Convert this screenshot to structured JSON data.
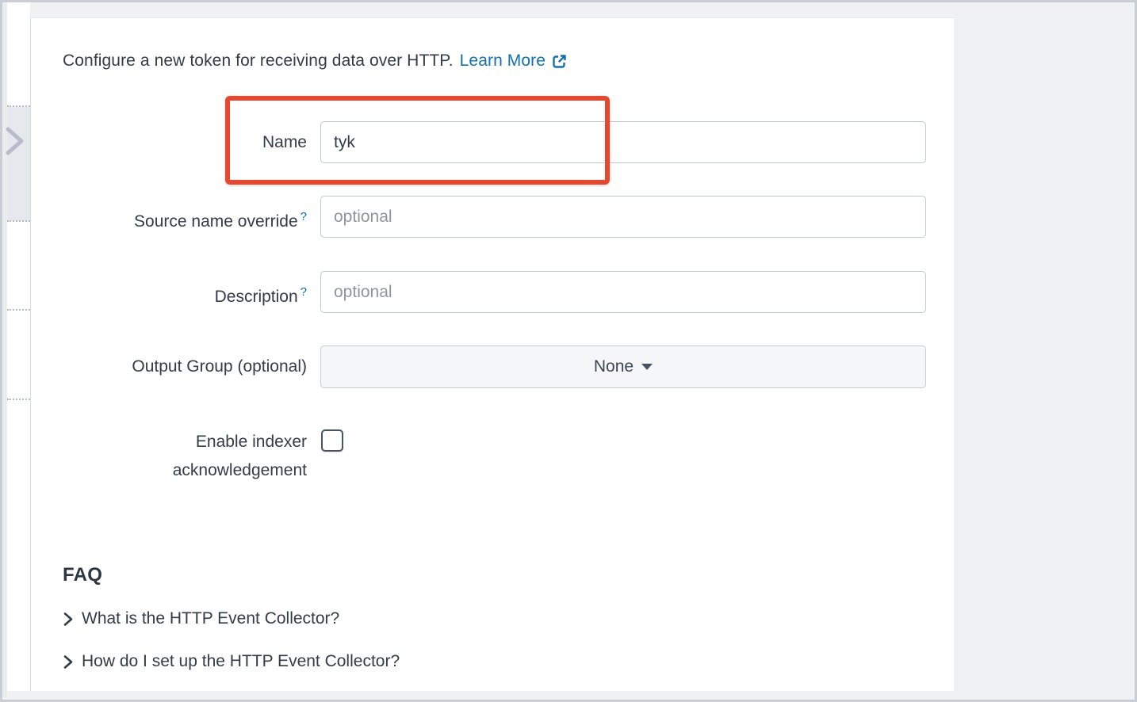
{
  "header": {
    "intro_text": "Configure a new token for receiving data over HTTP.",
    "learn_more_label": "Learn More"
  },
  "form": {
    "name": {
      "label": "Name",
      "value": "tyk"
    },
    "source_override": {
      "label": "Source name override",
      "help": "?",
      "placeholder": "optional"
    },
    "description": {
      "label": "Description",
      "help": "?",
      "placeholder": "optional"
    },
    "output_group": {
      "label": "Output Group (optional)",
      "selected_value": "None"
    },
    "indexer_ack": {
      "label_line1": "Enable indexer",
      "label_line2": "acknowledgement",
      "checked": false
    }
  },
  "faq": {
    "title": "FAQ",
    "items": [
      {
        "label": "What is the HTTP Event Collector?"
      },
      {
        "label": "How do I set up the HTTP Event Collector?"
      }
    ]
  },
  "annotation": {
    "type": "highlight-box",
    "color": "#e8472e"
  },
  "colors": {
    "link_blue": "#1170ad",
    "text_dark": "#333b49",
    "placeholder_gray": "#8e959e",
    "panel_bg": "#ffffff",
    "page_bg": "#eff1f3"
  }
}
